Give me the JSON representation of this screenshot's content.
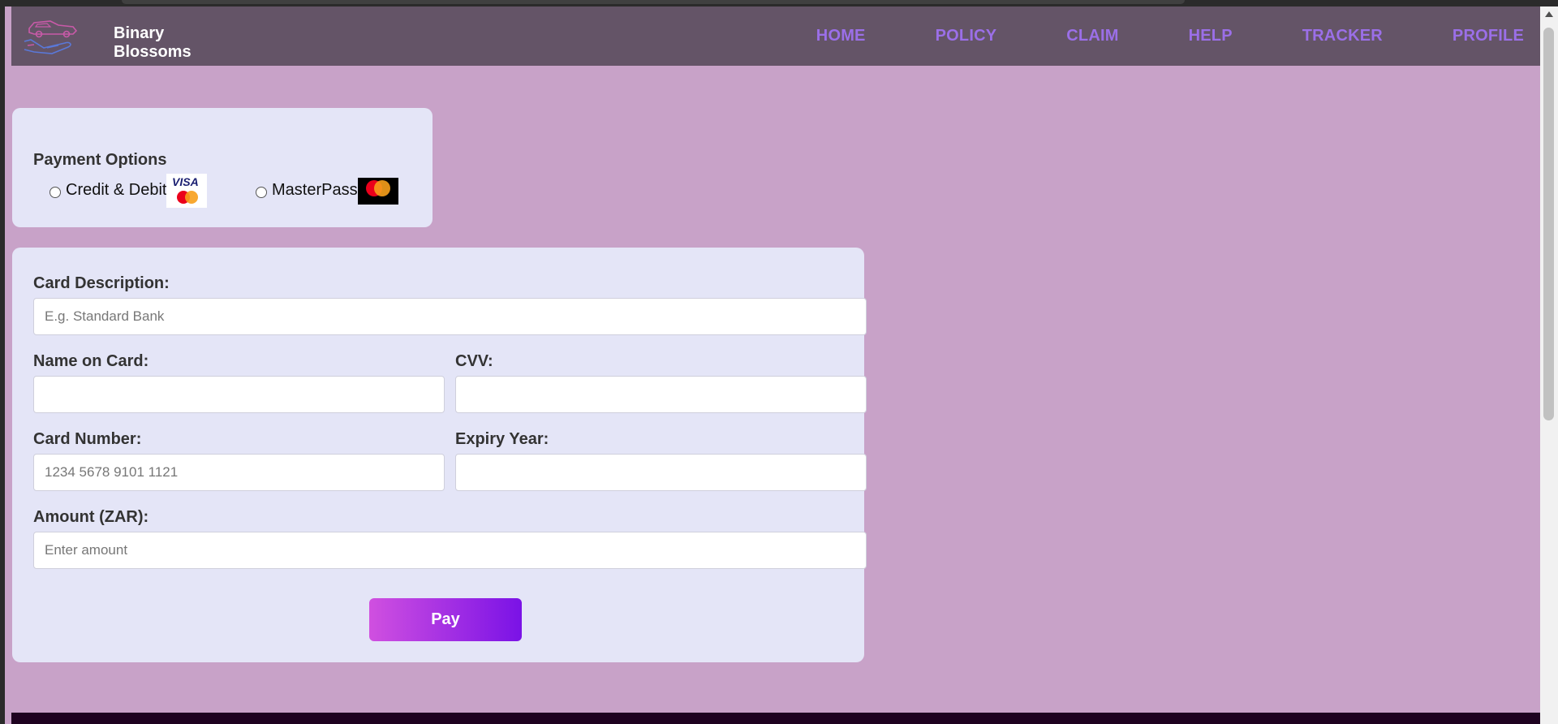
{
  "brand": {
    "name": "Binary\nBlossoms"
  },
  "nav": {
    "items": [
      {
        "label": "HOME"
      },
      {
        "label": "POLICY"
      },
      {
        "label": "CLAIM"
      },
      {
        "label": "HELP"
      },
      {
        "label": "TRACKER"
      },
      {
        "label": "PROFILE"
      }
    ]
  },
  "payment_options": {
    "title": "Payment Options",
    "credit_debit_label": "Credit & Debit",
    "credit_debit_selected": false,
    "masterpass_label": "MasterPass",
    "masterpass_selected": false,
    "visa_text": "VISA"
  },
  "form": {
    "card_description": {
      "label": "Card Description:",
      "value": "",
      "placeholder": "E.g. Standard Bank"
    },
    "name_on_card": {
      "label": "Name on Card:",
      "value": "",
      "placeholder": ""
    },
    "cvv": {
      "label": "CVV:",
      "value": "",
      "placeholder": ""
    },
    "card_number": {
      "label": "Card Number:",
      "value": "",
      "placeholder": "1234 5678 9101 1121"
    },
    "expiry_year": {
      "label": "Expiry Year:",
      "value": "",
      "placeholder": ""
    },
    "amount": {
      "label": "Amount (ZAR):",
      "value": "",
      "placeholder": "Enter amount"
    },
    "pay_label": "Pay"
  },
  "colors": {
    "page_bg": "#c8a2c8",
    "navbar_bg": "#645467",
    "nav_link": "#9b6fe8",
    "card_bg": "#e4e5f7",
    "pay_gradient_start": "#d050e0",
    "pay_gradient_end": "#7a12e6",
    "footer_bg": "#1e0220"
  }
}
